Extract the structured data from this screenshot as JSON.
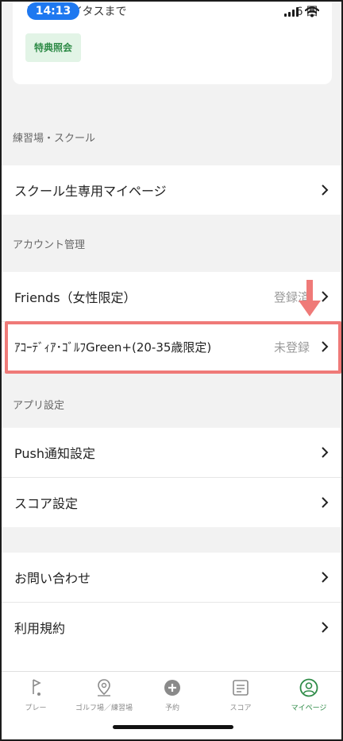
{
  "status_bar": {
    "time": "14:13"
  },
  "top_card": {
    "next_status_text": "次のステイタスまで",
    "next_status_count": "6 回",
    "benefit_button": "特典照会"
  },
  "sections": {
    "practice": {
      "header": "練習場・スクール",
      "items": [
        {
          "label": "スクール生専用マイページ"
        }
      ]
    },
    "account": {
      "header": "アカウント管理",
      "items": [
        {
          "label": "Friends（女性限定）",
          "value": "登録済"
        },
        {
          "label": "ｱｺｰﾃﾞｨｱ･ｺﾞﾙﾌGreen+(20-35歳限定)",
          "value": "未登録"
        }
      ]
    },
    "app_settings": {
      "header": "アプリ設定",
      "items": [
        {
          "label": "Push通知設定"
        },
        {
          "label": "スコア設定"
        }
      ]
    },
    "support": {
      "items": [
        {
          "label": "お問い合わせ"
        },
        {
          "label": "利用規約"
        }
      ]
    }
  },
  "tab_bar": {
    "items": [
      {
        "label": "プレー",
        "icon": "golf-flag-icon"
      },
      {
        "label": "ゴルフ場／練習場",
        "icon": "location-pin-icon"
      },
      {
        "label": "予約",
        "icon": "plus-circle-icon"
      },
      {
        "label": "スコア",
        "icon": "scorecard-icon"
      },
      {
        "label": "マイページ",
        "icon": "user-circle-icon",
        "active": true
      }
    ]
  },
  "colors": {
    "accent_green": "#2e8b47",
    "highlight_red": "#ef7a78",
    "time_pill_blue": "#1e78f0"
  }
}
